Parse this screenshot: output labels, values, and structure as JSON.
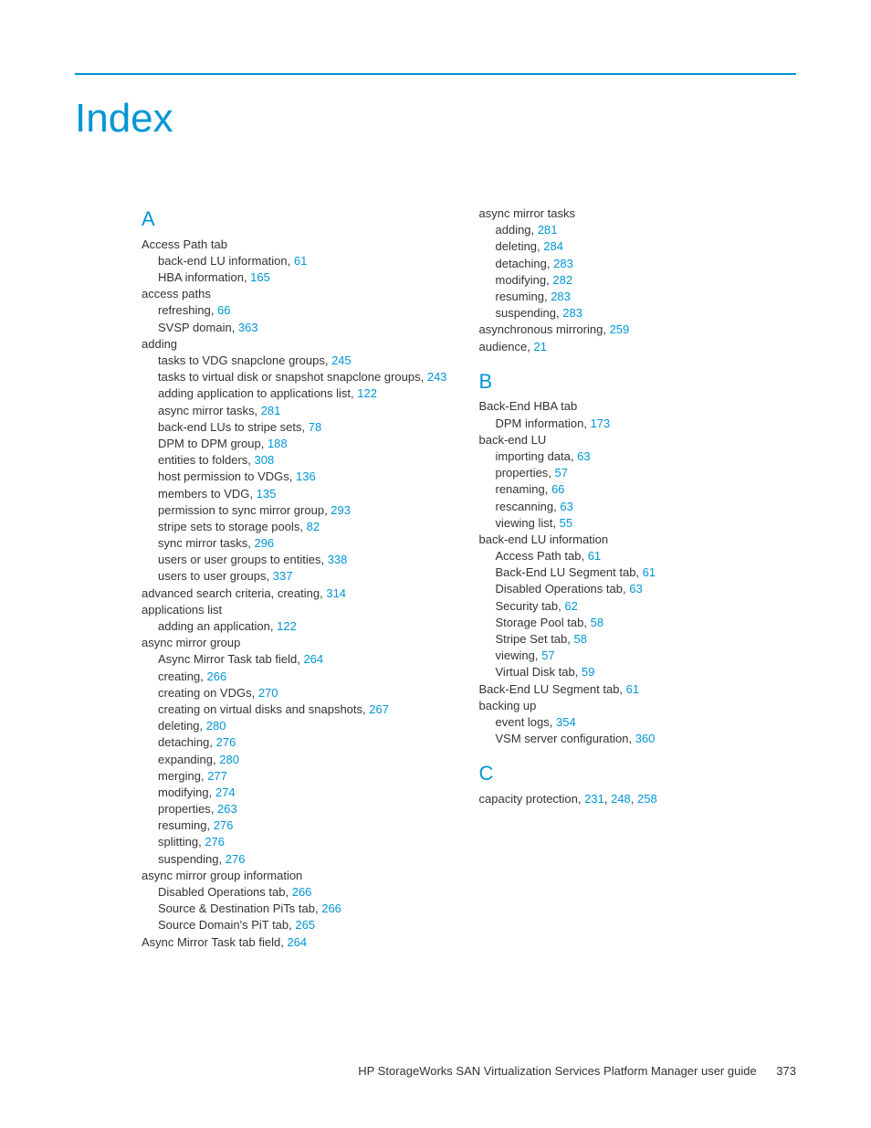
{
  "title": "Index",
  "footer": {
    "text": "HP StorageWorks SAN Virtualization Services Platform Manager user guide",
    "page": "373"
  },
  "columns": [
    {
      "sections": [
        {
          "letter": "A",
          "entries": [
            {
              "level": 0,
              "text": "Access Path tab",
              "pages": []
            },
            {
              "level": 1,
              "text": "back-end LU information",
              "pages": [
                "61"
              ]
            },
            {
              "level": 1,
              "text": "HBA information",
              "pages": [
                "165"
              ]
            },
            {
              "level": 0,
              "text": "access paths",
              "pages": []
            },
            {
              "level": 1,
              "text": "refreshing",
              "pages": [
                "66"
              ]
            },
            {
              "level": 1,
              "text": "SVSP domain",
              "pages": [
                "363"
              ]
            },
            {
              "level": 0,
              "text": "adding",
              "pages": []
            },
            {
              "level": 1,
              "text": "tasks to VDG snapclone groups",
              "pages": [
                "245"
              ]
            },
            {
              "level": 1,
              "text": "tasks to virtual disk or snapshot snapclone groups",
              "pages": [
                "243"
              ]
            },
            {
              "level": 1,
              "text": "adding application to applications list",
              "pages": [
                "122"
              ]
            },
            {
              "level": 1,
              "text": "async mirror tasks",
              "pages": [
                "281"
              ]
            },
            {
              "level": 1,
              "text": "back-end LUs to stripe sets",
              "pages": [
                "78"
              ]
            },
            {
              "level": 1,
              "text": "DPM to DPM group",
              "pages": [
                "188"
              ]
            },
            {
              "level": 1,
              "text": "entities to folders",
              "pages": [
                "308"
              ]
            },
            {
              "level": 1,
              "text": "host permission to VDGs",
              "pages": [
                "136"
              ]
            },
            {
              "level": 1,
              "text": "members to VDG",
              "pages": [
                "135"
              ]
            },
            {
              "level": 1,
              "text": "permission to sync mirror group",
              "pages": [
                "293"
              ]
            },
            {
              "level": 1,
              "text": "stripe sets to storage pools",
              "pages": [
                "82"
              ]
            },
            {
              "level": 1,
              "text": "sync mirror tasks",
              "pages": [
                "296"
              ]
            },
            {
              "level": 1,
              "text": "users or user groups to entities",
              "pages": [
                "338"
              ]
            },
            {
              "level": 1,
              "text": "users to user groups",
              "pages": [
                "337"
              ]
            },
            {
              "level": 0,
              "text": "advanced search criteria, creating",
              "pages": [
                "314"
              ]
            },
            {
              "level": 0,
              "text": "applications list",
              "pages": []
            },
            {
              "level": 1,
              "text": "adding an application",
              "pages": [
                "122"
              ]
            },
            {
              "level": 0,
              "text": "async mirror group",
              "pages": []
            },
            {
              "level": 1,
              "text": "Async Mirror Task tab field",
              "pages": [
                "264"
              ]
            },
            {
              "level": 1,
              "text": "creating",
              "pages": [
                "266"
              ]
            },
            {
              "level": 1,
              "text": "creating on VDGs",
              "pages": [
                "270"
              ]
            },
            {
              "level": 1,
              "text": "creating on virtual disks and snapshots",
              "pages": [
                "267"
              ]
            },
            {
              "level": 1,
              "text": "deleting",
              "pages": [
                "280"
              ]
            },
            {
              "level": 1,
              "text": "detaching",
              "pages": [
                "276"
              ]
            },
            {
              "level": 1,
              "text": "expanding",
              "pages": [
                "280"
              ]
            },
            {
              "level": 1,
              "text": "merging",
              "pages": [
                "277"
              ]
            },
            {
              "level": 1,
              "text": "modifying",
              "pages": [
                "274"
              ]
            },
            {
              "level": 1,
              "text": "properties",
              "pages": [
                "263"
              ]
            },
            {
              "level": 1,
              "text": "resuming",
              "pages": [
                "276"
              ]
            },
            {
              "level": 1,
              "text": "splitting",
              "pages": [
                "276"
              ]
            },
            {
              "level": 1,
              "text": "suspending",
              "pages": [
                "276"
              ]
            },
            {
              "level": 0,
              "text": "async mirror group information",
              "pages": []
            },
            {
              "level": 1,
              "text": "Disabled Operations tab",
              "pages": [
                "266"
              ]
            },
            {
              "level": 1,
              "text": "Source & Destination PiTs tab",
              "pages": [
                "266"
              ]
            },
            {
              "level": 1,
              "text": "Source Domain's PiT tab",
              "pages": [
                "265"
              ]
            },
            {
              "level": 0,
              "text": "Async Mirror Task tab field",
              "pages": [
                "264"
              ]
            }
          ]
        }
      ]
    },
    {
      "sections": [
        {
          "letter": "",
          "entries": [
            {
              "level": 0,
              "text": "async mirror tasks",
              "pages": []
            },
            {
              "level": 1,
              "text": "adding",
              "pages": [
                "281"
              ]
            },
            {
              "level": 1,
              "text": "deleting",
              "pages": [
                "284"
              ]
            },
            {
              "level": 1,
              "text": "detaching",
              "pages": [
                "283"
              ]
            },
            {
              "level": 1,
              "text": "modifying",
              "pages": [
                "282"
              ]
            },
            {
              "level": 1,
              "text": "resuming",
              "pages": [
                "283"
              ]
            },
            {
              "level": 1,
              "text": "suspending",
              "pages": [
                "283"
              ]
            },
            {
              "level": 0,
              "text": "asynchronous mirroring",
              "pages": [
                "259"
              ]
            },
            {
              "level": 0,
              "text": "audience",
              "pages": [
                "21"
              ]
            }
          ]
        },
        {
          "letter": "B",
          "entries": [
            {
              "level": 0,
              "text": "Back-End HBA tab",
              "pages": []
            },
            {
              "level": 1,
              "text": "DPM information",
              "pages": [
                "173"
              ]
            },
            {
              "level": 0,
              "text": "back-end LU",
              "pages": []
            },
            {
              "level": 1,
              "text": "importing data",
              "pages": [
                "63"
              ]
            },
            {
              "level": 1,
              "text": "properties",
              "pages": [
                "57"
              ]
            },
            {
              "level": 1,
              "text": "renaming",
              "pages": [
                "66"
              ]
            },
            {
              "level": 1,
              "text": "rescanning",
              "pages": [
                "63"
              ]
            },
            {
              "level": 1,
              "text": "viewing list",
              "pages": [
                "55"
              ]
            },
            {
              "level": 0,
              "text": "back-end LU information",
              "pages": []
            },
            {
              "level": 1,
              "text": "Access Path tab",
              "pages": [
                "61"
              ]
            },
            {
              "level": 1,
              "text": "Back-End LU Segment tab",
              "pages": [
                "61"
              ]
            },
            {
              "level": 1,
              "text": "Disabled Operations tab",
              "pages": [
                "63"
              ]
            },
            {
              "level": 1,
              "text": "Security tab",
              "pages": [
                "62"
              ]
            },
            {
              "level": 1,
              "text": "Storage Pool tab",
              "pages": [
                "58"
              ]
            },
            {
              "level": 1,
              "text": "Stripe Set tab",
              "pages": [
                "58"
              ]
            },
            {
              "level": 1,
              "text": "viewing",
              "pages": [
                "57"
              ]
            },
            {
              "level": 1,
              "text": "Virtual Disk tab",
              "pages": [
                "59"
              ]
            },
            {
              "level": 0,
              "text": "Back-End LU Segment tab",
              "pages": [
                "61"
              ]
            },
            {
              "level": 0,
              "text": "backing up",
              "pages": []
            },
            {
              "level": 1,
              "text": "event logs",
              "pages": [
                "354"
              ]
            },
            {
              "level": 1,
              "text": "VSM server configuration",
              "pages": [
                "360"
              ]
            }
          ]
        },
        {
          "letter": "C",
          "entries": [
            {
              "level": 0,
              "text": "capacity protection",
              "pages": [
                "231",
                "248",
                "258"
              ]
            }
          ]
        }
      ]
    }
  ]
}
